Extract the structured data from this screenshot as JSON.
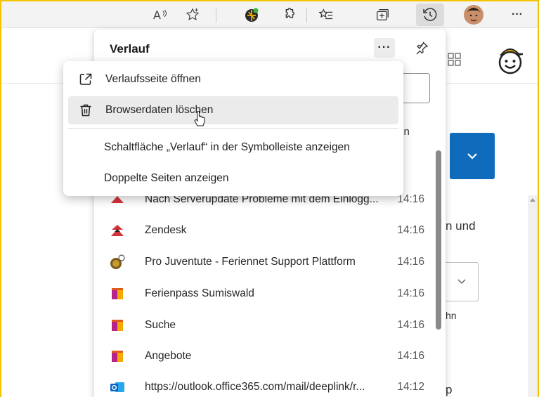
{
  "toolbar": {
    "items": [
      {
        "name": "read-aloud-icon",
        "glyph": "A⁾"
      },
      {
        "name": "favorite-star-icon",
        "glyph": "☆"
      },
      {
        "name": "extension-colored-icon",
        "glyph": ""
      },
      {
        "name": "extensions-puzzle-icon",
        "glyph": ""
      },
      {
        "name": "favorites-list-icon",
        "glyph": ""
      },
      {
        "name": "collections-icon",
        "glyph": ""
      },
      {
        "name": "history-icon",
        "glyph": ""
      },
      {
        "name": "profile-avatar",
        "glyph": ""
      },
      {
        "name": "more-menu-icon",
        "glyph": "···"
      }
    ]
  },
  "page": {
    "text_und": "n und",
    "text_n": "hn",
    "text_p": "p"
  },
  "history_panel": {
    "title": "Verlauf",
    "more_label": "···",
    "tab_tail": "ten",
    "items": [
      {
        "title": "Nach Serverupdate Probleme mit dem Einlogg...",
        "time": "14:16",
        "icon": "zendesk-icon"
      },
      {
        "title": "Zendesk",
        "time": "14:16",
        "icon": "zendesk-icon"
      },
      {
        "title": "Pro Juventute - Feriennet Support Plattform",
        "time": "14:16",
        "icon": "pro-juventute-icon"
      },
      {
        "title": "Ferienpass Sumiswald",
        "time": "14:16",
        "icon": "ferienpass-icon"
      },
      {
        "title": "Suche",
        "time": "14:16",
        "icon": "ferienpass-icon"
      },
      {
        "title": "Angebote",
        "time": "14:16",
        "icon": "ferienpass-icon"
      },
      {
        "title": "https://outlook.office365.com/mail/deeplink/r...",
        "time": "14:12",
        "icon": "outlook-icon"
      }
    ]
  },
  "context_menu": {
    "items": [
      {
        "label": "Verlaufsseite öffnen",
        "icon": "open-external-icon"
      },
      {
        "label": "Browserdaten löschen",
        "icon": "trash-icon"
      },
      {
        "label": "Schaltfläche „Verlauf“ in der Symbolleiste anzeigen",
        "icon": ""
      },
      {
        "label": "Doppelte Seiten anzeigen",
        "icon": ""
      }
    ]
  },
  "colors": {
    "frame": "#f5c400",
    "accent_blue": "#0f6cbd",
    "zendesk_red": "#d3333a",
    "outlook_blue": "#0a64c8"
  }
}
